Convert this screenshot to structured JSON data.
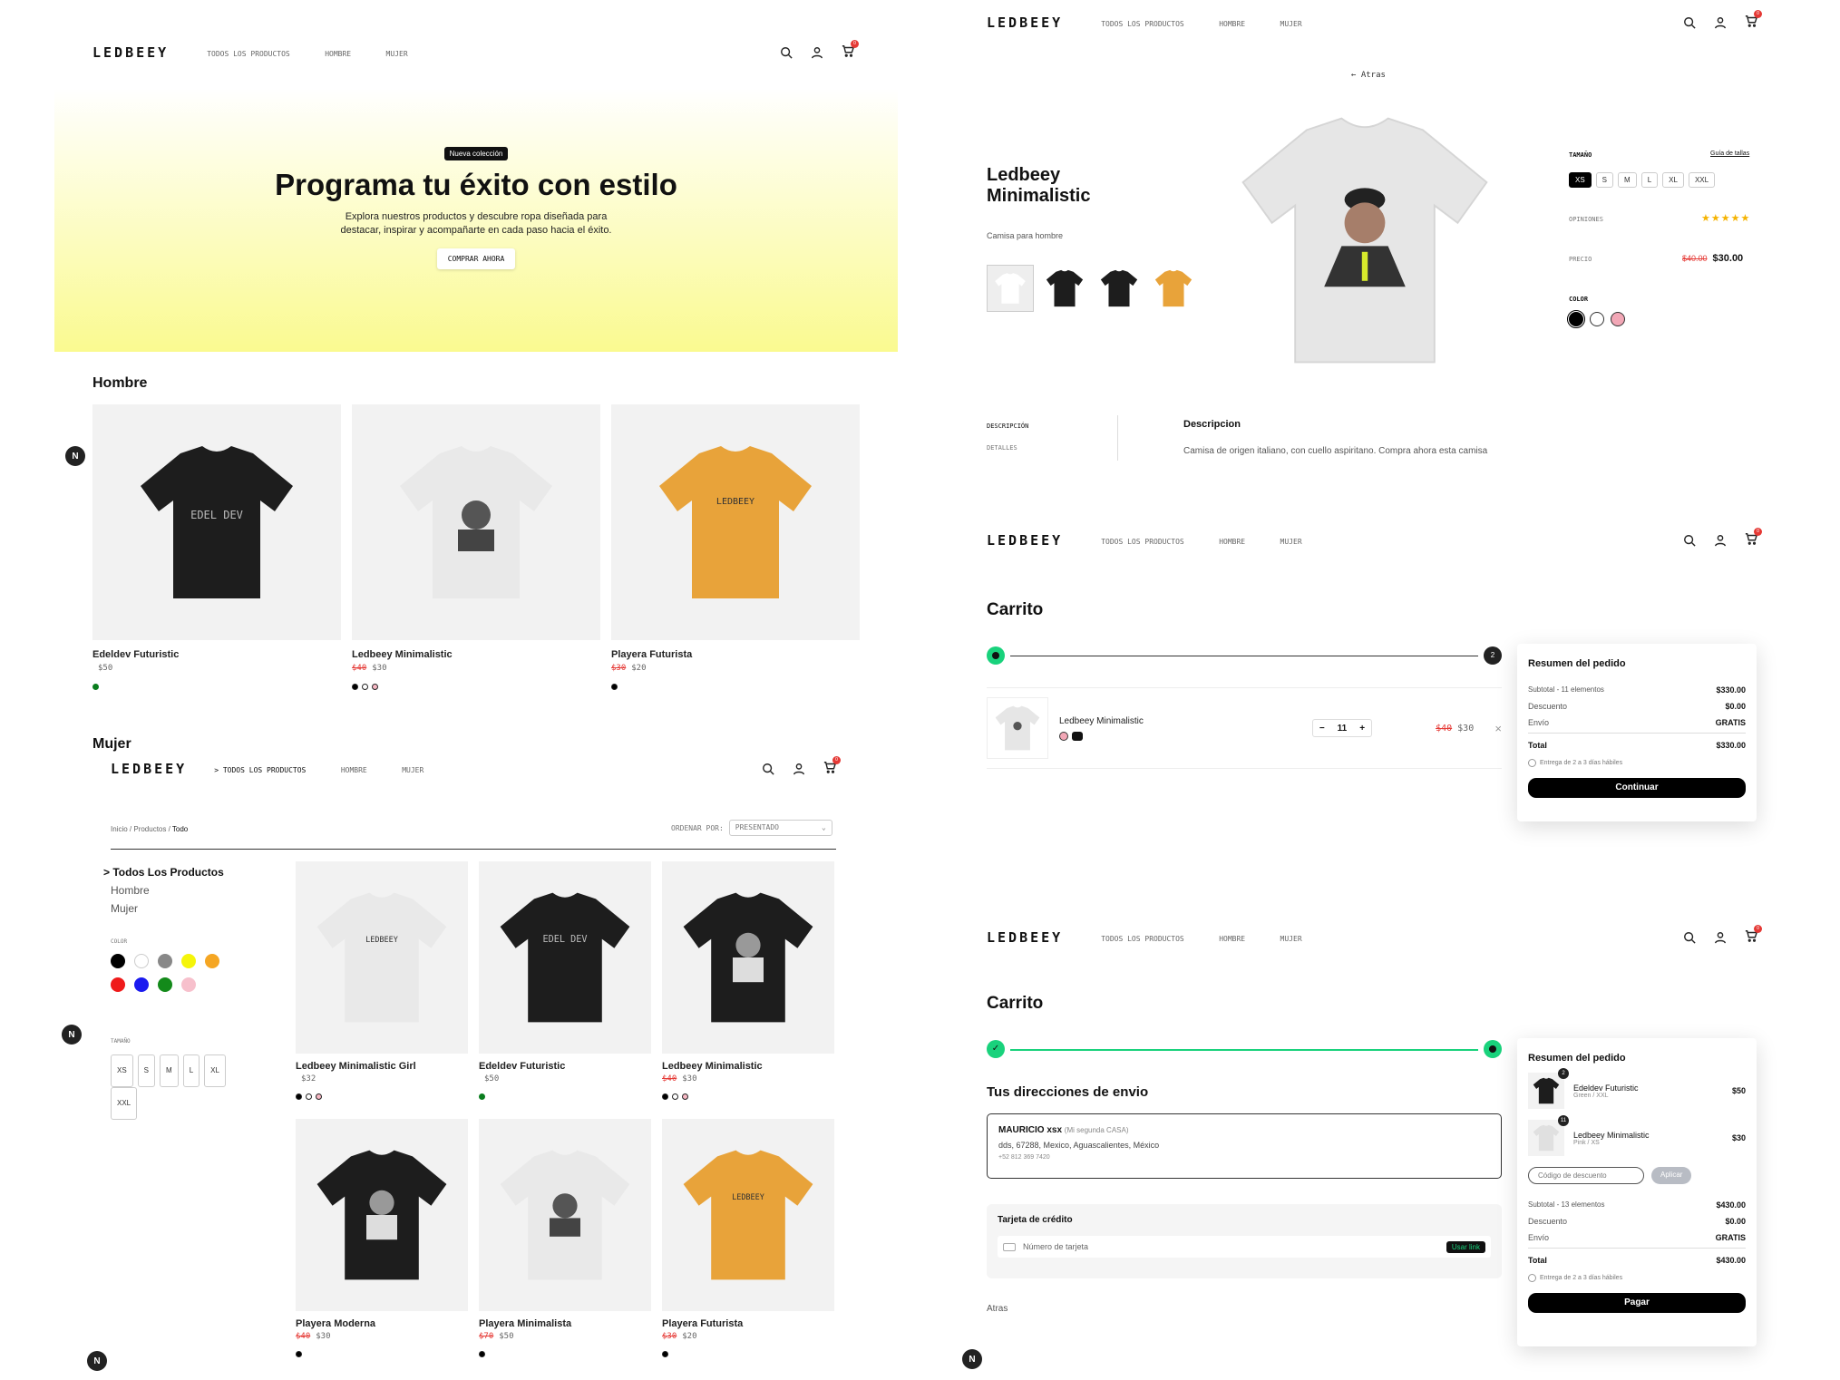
{
  "nav": {
    "logo": "LEDBEEY",
    "all": "TODOS LOS PRODUCTOS",
    "men": "HOMBRE",
    "women": "MUJER",
    "all_active": "> TODOS LOS PRODUCTOS",
    "cart_count": "0"
  },
  "hero": {
    "badge": "Nueva colección",
    "title": "Programa tu éxito con estilo",
    "line1": "Explora nuestros productos y descubre ropa diseñada para",
    "line2": "destacar, inspirar y acompañarte en cada paso hacia el éxito.",
    "cta": "COMPRAR AHORA"
  },
  "men": {
    "title": "Hombre",
    "products": [
      {
        "name": "Edeldev Futuristic",
        "price": "$50",
        "old": ""
      },
      {
        "name": "Ledbeey Minimalistic",
        "price": "$30",
        "old": "$40"
      },
      {
        "name": "Playera Futurista",
        "price": "$20",
        "old": "$30"
      }
    ]
  },
  "women": {
    "title": "Mujer"
  },
  "catalog": {
    "crumb1": "Inicio /",
    "crumb2": "Productos /",
    "crumb3": "Todo",
    "sort_label": "ORDENAR POR:",
    "sort_value": "PRESENTADO",
    "cats": [
      "> Todos Los Productos",
      "Hombre",
      "Mujer"
    ],
    "color_label": "COLOR",
    "size_label": "TAMAÑO",
    "sizes": [
      "XS",
      "S",
      "M",
      "L",
      "XL",
      "XXL"
    ],
    "products": [
      {
        "name": "Ledbeey Minimalistic Girl",
        "price": "$32",
        "old": ""
      },
      {
        "name": "Edeldev Futuristic",
        "price": "$50",
        "old": ""
      },
      {
        "name": "Ledbeey Minimalistic",
        "price": "$30",
        "old": "$40"
      },
      {
        "name": "Playera Moderna",
        "price": "$30",
        "old": "$40"
      },
      {
        "name": "Playera Minimalista",
        "price": "$50",
        "old": "$70"
      },
      {
        "name": "Playera Futurista",
        "price": "$20",
        "old": "$30"
      }
    ]
  },
  "detail": {
    "back": "Atras",
    "title1": "Ledbeey",
    "title2": "Minimalistic",
    "subtitle": "Camisa para hombre",
    "size_label": "TAMAÑO",
    "size_guide": "Guía de tallas",
    "reviews_label": "OPINIONES",
    "stars": "★★★★★",
    "price_label": "PRECIO",
    "old_price": "$40.00",
    "price": "$30.00",
    "color_label": "COLOR",
    "tab1": "DESCRIPCIÓN",
    "tab2": "DETALLES",
    "desc_title": "Descripcion",
    "desc": "Camisa de origen italiano, con cuello aspiritano. Compra ahora esta camisa"
  },
  "cart": {
    "title": "Carrito",
    "step": "2",
    "item": "Ledbeey Minimalistic",
    "qty": "11",
    "old": "$40",
    "price": "$30",
    "summary_title": "Resumen del pedido",
    "subtotal_label": "Subtotal - 11 elementos",
    "subtotal": "$330.00",
    "discount_label": "Descuento",
    "discount": "$0.00",
    "shipping_label": "Envío",
    "shipping": "GRATIS",
    "total_label": "Total",
    "total": "$330.00",
    "delivery": "Entrega de 2 a 3 días hábiles",
    "continue": "Continuar"
  },
  "checkout": {
    "title": "Carrito",
    "address_title": "Tus direcciones de envio",
    "name": "MAURICIO xsx",
    "tag": "(Mi segunda CASA)",
    "address": "dds, 67288, Mexico, Aguascalientes, México",
    "phone": "+52 812 369 7420",
    "card_title": "Tarjeta de crédito",
    "card_placeholder": "Número de tarjeta",
    "link": "Usar link",
    "back": "Atras",
    "summary_title": "Resumen del pedido",
    "items": [
      {
        "name": "Edeldev Futuristic",
        "variant": "Green / XXL",
        "price": "$50",
        "count": "2"
      },
      {
        "name": "Ledbeey Minimalistic",
        "variant": "Pink / XS",
        "price": "$30",
        "count": "11"
      }
    ],
    "coupon": "Código de descuento",
    "apply": "Aplicar",
    "subtotal_label": "Subtotal - 13 elementos",
    "subtotal": "$430.00",
    "discount_label": "Descuento",
    "discount": "$0.00",
    "shipping_label": "Envío",
    "shipping": "GRATIS",
    "total_label": "Total",
    "total": "$430.00",
    "delivery": "Entrega de 2 a 3 días hábiles",
    "pay": "Pagar"
  },
  "next_badge": "N",
  "colors": {
    "hero_top": "#ffffff",
    "hero_bottom": "#fafa90",
    "accent_green": "#19d27c",
    "sale_red": "#e53935",
    "star": "#f5b301"
  }
}
